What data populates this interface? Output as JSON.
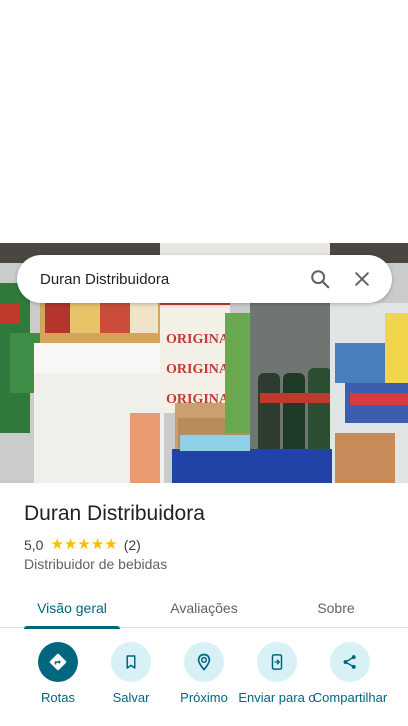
{
  "search": {
    "query": "Duran Distribuidora",
    "search_icon": "search-icon",
    "close_icon": "close-icon"
  },
  "photo": {
    "signs": [
      "ORIGINAL",
      "ORIGINAL",
      "ORIGINAL"
    ]
  },
  "place": {
    "title": "Duran Distribuidora",
    "rating_value": "5,0",
    "rating_fraction": 1.0,
    "review_count": "(2)",
    "category": "Distribuidor de bebidas"
  },
  "tabs": [
    {
      "label": "Visão geral",
      "active": true
    },
    {
      "label": "Avaliações",
      "active": false
    },
    {
      "label": "Sobre",
      "active": false
    }
  ],
  "actions": [
    {
      "label": "Rotas",
      "icon": "directions-icon"
    },
    {
      "label": "Salvar",
      "icon": "bookmark-icon"
    },
    {
      "label": "Próximo",
      "icon": "nearby-icon"
    },
    {
      "label": "Enviar para o",
      "icon": "send-to-phone-icon"
    },
    {
      "label": "Compartilhar",
      "icon": "share-icon"
    }
  ],
  "colors": {
    "accent": "#00677f",
    "accent_light": "#d7f1f6",
    "star": "#fbbc04"
  }
}
